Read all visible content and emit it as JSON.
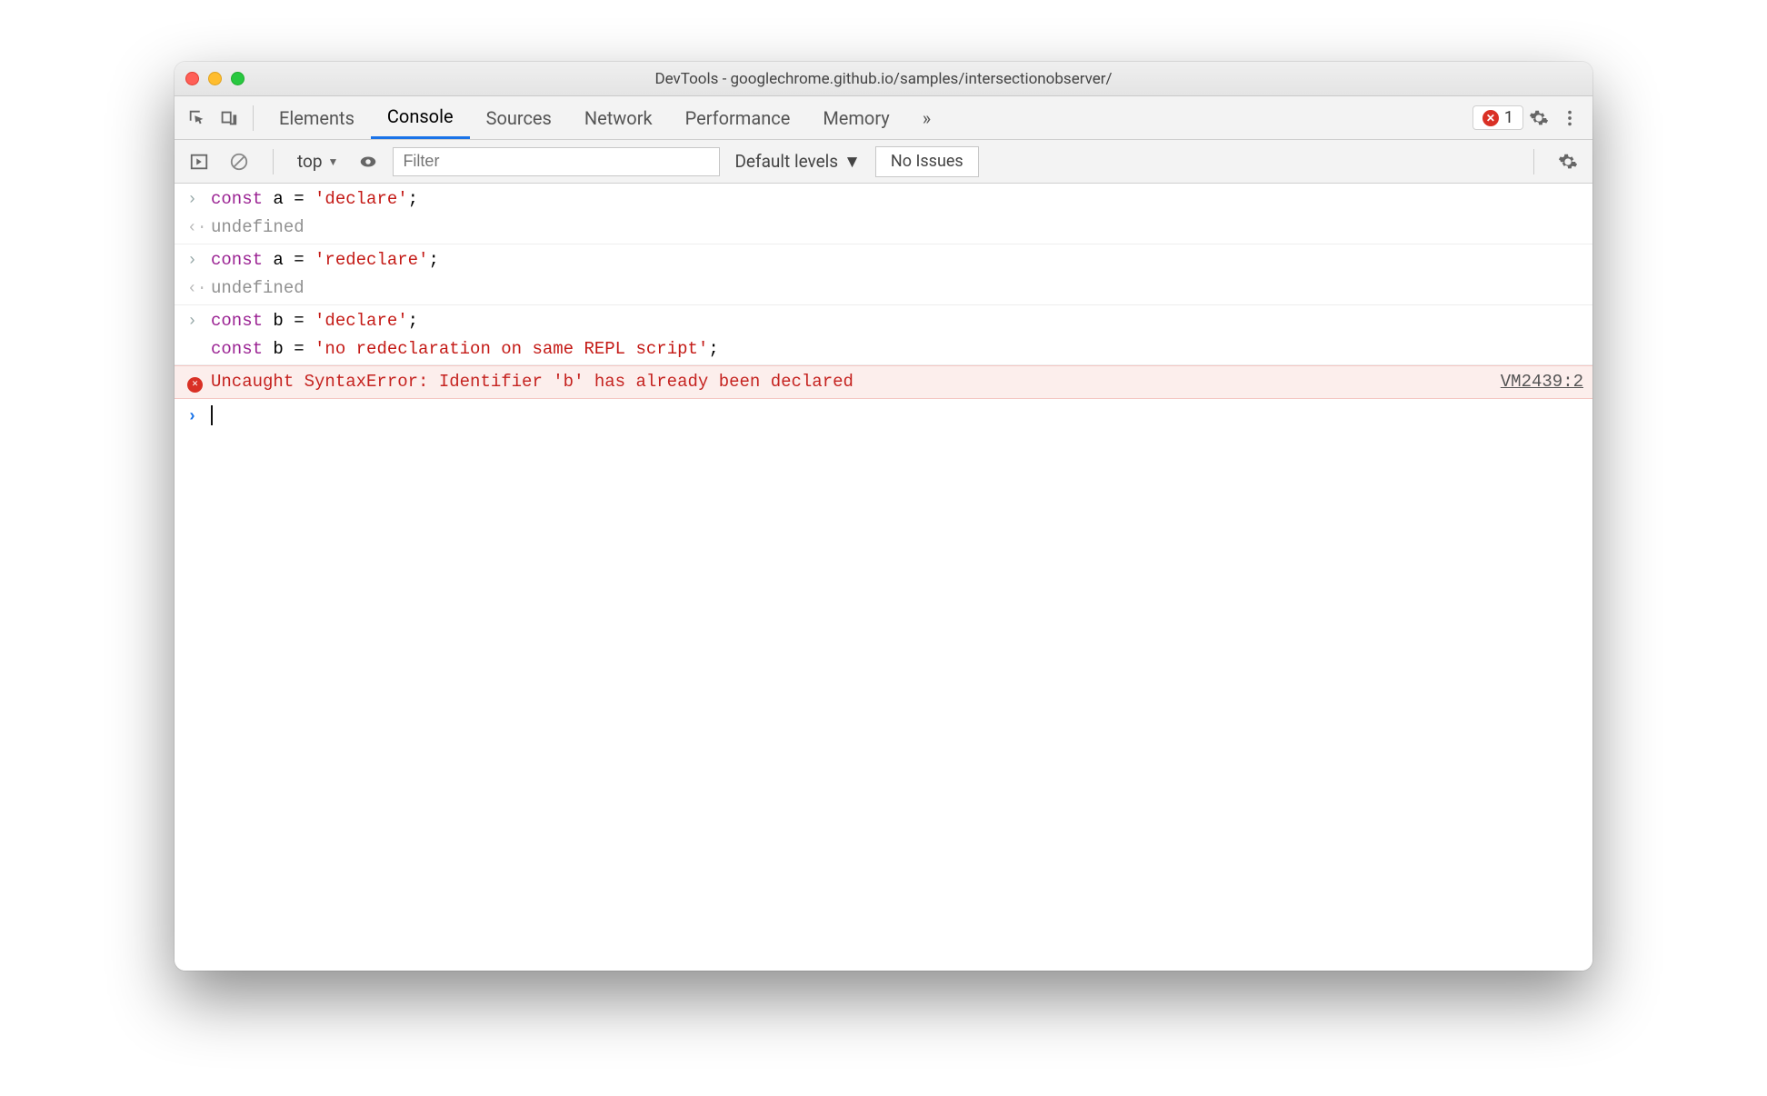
{
  "window": {
    "title": "DevTools - googlechrome.github.io/samples/intersectionobserver/"
  },
  "tabs": {
    "items": [
      "Elements",
      "Console",
      "Sources",
      "Network",
      "Performance",
      "Memory"
    ],
    "active": "Console",
    "overflow_glyph": "»"
  },
  "toolbar": {
    "error_count": "1"
  },
  "filterbar": {
    "context": "top",
    "filter_placeholder": "Filter",
    "levels_label": "Default levels",
    "no_issues_label": "No Issues"
  },
  "console_entries": [
    {
      "type": "input",
      "tokens": [
        {
          "t": "const ",
          "c": "kw"
        },
        {
          "t": "a = ",
          "c": ""
        },
        {
          "t": "'declare'",
          "c": "str"
        },
        {
          "t": ";",
          "c": ""
        }
      ]
    },
    {
      "type": "output",
      "text": "undefined",
      "cls": "undef"
    },
    {
      "type": "input",
      "tokens": [
        {
          "t": "const ",
          "c": "kw"
        },
        {
          "t": "a = ",
          "c": ""
        },
        {
          "t": "'redeclare'",
          "c": "str"
        },
        {
          "t": ";",
          "c": ""
        }
      ]
    },
    {
      "type": "output",
      "text": "undefined",
      "cls": "undef"
    },
    {
      "type": "input-multi",
      "lines": [
        [
          {
            "t": "const ",
            "c": "kw"
          },
          {
            "t": "b = ",
            "c": ""
          },
          {
            "t": "'declare'",
            "c": "str"
          },
          {
            "t": ";",
            "c": ""
          }
        ],
        [
          {
            "t": "const ",
            "c": "kw"
          },
          {
            "t": "b = ",
            "c": ""
          },
          {
            "t": "'no redeclaration on same REPL script'",
            "c": "str"
          },
          {
            "t": ";",
            "c": ""
          }
        ]
      ]
    },
    {
      "type": "error",
      "text": "Uncaught SyntaxError: Identifier 'b' has already been declared",
      "source": "VM2439:2"
    }
  ]
}
